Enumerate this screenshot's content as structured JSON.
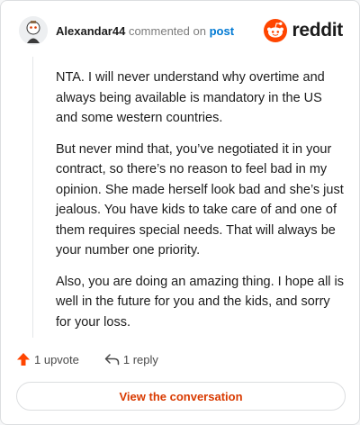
{
  "comment": {
    "author": "Alexandar44",
    "action": "commented on",
    "target": "post",
    "paragraphs": [
      "NTA. I will never understand why overtime and always being available is mandatory in the US and some western countries.",
      "But never mind that, you’ve negotiated it in your contract, so there’s no reason to feel bad in my opinion. She made herself look bad and she’s just jealous. You have kids to take care of and one of them requires special needs. That will always be your number one priority.",
      "Also, you are doing an amazing thing. I hope all is well in the future for you and the kids, and sorry for your loss."
    ]
  },
  "brand": {
    "wordmark": "reddit",
    "color": "#ff4500"
  },
  "footer": {
    "upvotes": "1 upvote",
    "replies": "1 reply"
  },
  "cta": {
    "label": "View the conversation"
  },
  "icons": {
    "upvote": "upvote-arrow-icon",
    "reply": "reply-arrow-icon",
    "logo": "reddit-snoo-icon"
  }
}
